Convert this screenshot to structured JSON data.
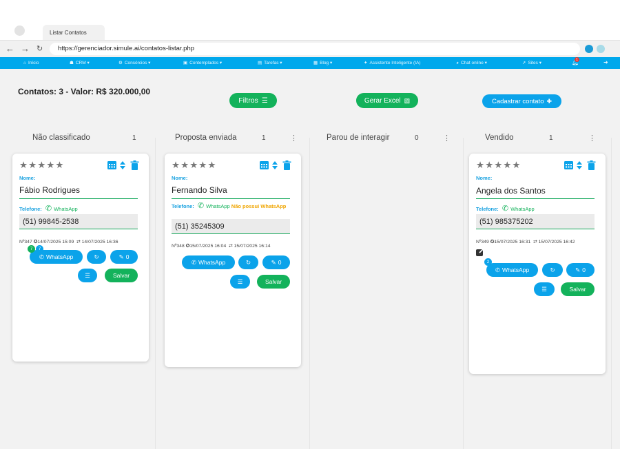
{
  "browser": {
    "tab_title": "Listar Contatos",
    "url": "https://gerenciador.simule.ai/contatos-listar.php"
  },
  "nav": {
    "items": [
      {
        "label": "Início",
        "icon": "home-icon"
      },
      {
        "label": "CRM",
        "icon": "users-icon",
        "dropdown": true
      },
      {
        "label": "Consórcios",
        "icon": "gear-icon",
        "dropdown": true
      },
      {
        "label": "Contemplados",
        "icon": "id-card-icon",
        "dropdown": true
      },
      {
        "label": "Tarefas",
        "icon": "clipboard-icon",
        "dropdown": true
      },
      {
        "label": "Blog",
        "icon": "image-icon",
        "dropdown": true
      },
      {
        "label": "Assistente Inteligente (IA)",
        "icon": "ai-icon"
      },
      {
        "label": "Chat online",
        "icon": "chat-icon",
        "dropdown": true
      },
      {
        "label": "Sites",
        "icon": "cursor-icon",
        "dropdown": true
      }
    ],
    "notification_badge": "1"
  },
  "summary": "Contatos: 3 - Valor: R$ 320.000,00",
  "toolbar": {
    "filters": "Filtros",
    "excel": "Gerar Excel",
    "add_contact": "Cadastrar contato"
  },
  "columns": [
    {
      "title": "Não classificado",
      "count": "1"
    },
    {
      "title": "Proposta enviada",
      "count": "1"
    },
    {
      "title": "Parou de interagir",
      "count": "0"
    },
    {
      "title": "Vendido",
      "count": "1"
    }
  ],
  "card_labels": {
    "name": "Nome:",
    "phone": "Telefone:",
    "whatsapp": "WhatsApp",
    "no_whatsapp": "Não possui WhatsApp",
    "save": "Salvar",
    "notes_count": "0"
  },
  "cards": [
    {
      "name": "Fábio Rodrigues",
      "phone": "(51) 99845-2538",
      "id": "Nº347",
      "created": "14/07/2025 15:09",
      "updated": "14/07/2025 16:36",
      "badge_green": "7",
      "badge_blue": "7"
    },
    {
      "name": "Fernando Silva",
      "phone": "(51) 35245309",
      "id": "Nº348",
      "created": "15/07/2025 16:04",
      "updated": "15/07/2025 16:14"
    },
    {
      "name": "Angela dos Santos",
      "phone": "(51) 985375202",
      "id": "Nº349",
      "created": "15/07/2025 16:31",
      "updated": "15/07/2025 16:42",
      "badge_blue": "2"
    }
  ],
  "colors": {
    "nav": "#00a8ec",
    "green": "#13b25b",
    "blue": "#0ba3ea",
    "label": "#1aa2e0",
    "warning": "#f0a500"
  }
}
